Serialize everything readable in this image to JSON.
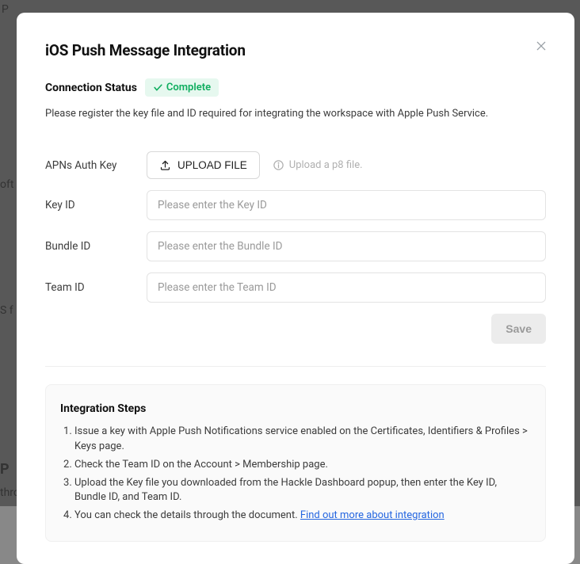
{
  "backgroundFragments": {
    "a": "P",
    "b": "oft",
    "c": "S f",
    "d": "P",
    "e": "through APN."
  },
  "modal": {
    "title": "iOS Push Message Integration",
    "status": {
      "label": "Connection Status",
      "badge": "Complete"
    },
    "description": "Please register the key file and ID required for integrating the workspace with Apple Push Service.",
    "form": {
      "authKeyLabel": "APNs Auth Key",
      "uploadButton": "UPLOAD FILE",
      "uploadHint": "Upload a p8 file.",
      "keyIdLabel": "Key ID",
      "keyIdPlaceholder": "Please enter the Key ID",
      "bundleIdLabel": "Bundle ID",
      "bundleIdPlaceholder": "Please enter the Bundle ID",
      "teamIdLabel": "Team ID",
      "teamIdPlaceholder": "Please enter the Team ID",
      "saveButton": "Save"
    },
    "steps": {
      "title": "Integration Steps",
      "items": [
        "Issue a key with Apple Push Notifications service enabled on the Certificates, Identifiers & Profiles > Keys page.",
        "Check the Team ID on the Account > Membership page.",
        "Upload the Key file you downloaded from the Hackle Dashboard popup, then enter the Key ID, Bundle ID, and Team ID.",
        "You can check the details through the document."
      ],
      "linkText": "Find out more about integration"
    }
  }
}
